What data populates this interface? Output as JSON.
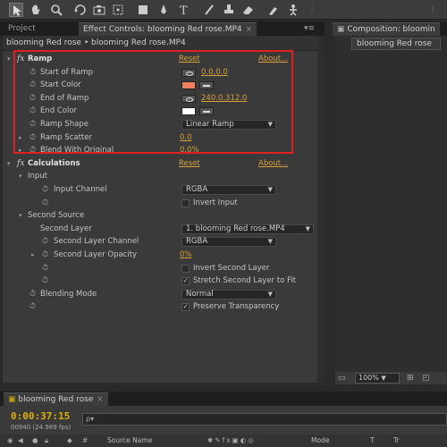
{
  "tabs": {
    "project": "Project",
    "effect_controls": "Effect Controls: blooming Red rose.MP4",
    "composition": "Composition: bloomin",
    "composition_subtab": "blooming Red rose",
    "timeline": "blooming Red rose"
  },
  "effect_controls": {
    "header": "blooming Red rose • blooming Red rose.MP4",
    "ramp": {
      "fx": "fx",
      "name": "Ramp",
      "reset": "Reset",
      "about": "About...",
      "start_of_ramp_label": "Start of Ramp",
      "start_of_ramp_value": "0.0,0.0",
      "start_color_label": "Start Color",
      "start_color": "#f08060",
      "end_of_ramp_label": "End of Ramp",
      "end_of_ramp_value": "240.0,312.0",
      "end_color_label": "End Color",
      "end_color": "#ffffff",
      "ramp_shape_label": "Ramp Shape",
      "ramp_shape_value": "Linear Ramp",
      "ramp_scatter_label": "Ramp Scatter",
      "ramp_scatter_value": "0.0",
      "blend_label": "Blend With Original",
      "blend_value": "0.0%"
    },
    "calculations": {
      "fx": "fx",
      "name": "Calculations",
      "reset": "Reset",
      "about": "About...",
      "input_label": "Input",
      "input_channel_label": "Input Channel",
      "input_channel_value": "RGBA",
      "invert_input_label": "Invert Input",
      "second_source_label": "Second Source",
      "second_layer_label": "Second Layer",
      "second_layer_value": "1. blooming Red rose.MP4",
      "second_layer_channel_label": "Second Layer Channel",
      "second_layer_channel_value": "RGBA",
      "second_layer_opacity_label": "Second Layer Opacity",
      "second_layer_opacity_value": "0%",
      "invert_second_layer_label": "Invert Second Layer",
      "stretch_label": "Stretch Second Layer to Fit",
      "blending_mode_label": "Blending Mode",
      "blending_mode_value": "Normal",
      "preserve_label": "Preserve Transparency"
    }
  },
  "composition": {
    "zoom": "100%"
  },
  "timeline": {
    "timecode": "0:00:37:15",
    "frame_info": "00940 (24.989 fps)",
    "search_placeholder": "ρ▾",
    "col_source_name": "Source Name",
    "col_mode": "Mode",
    "col_t": "T",
    "col_trk": "Tr"
  },
  "colors": {
    "accent": "#d8a03a",
    "highlight_box": "#e02020"
  }
}
